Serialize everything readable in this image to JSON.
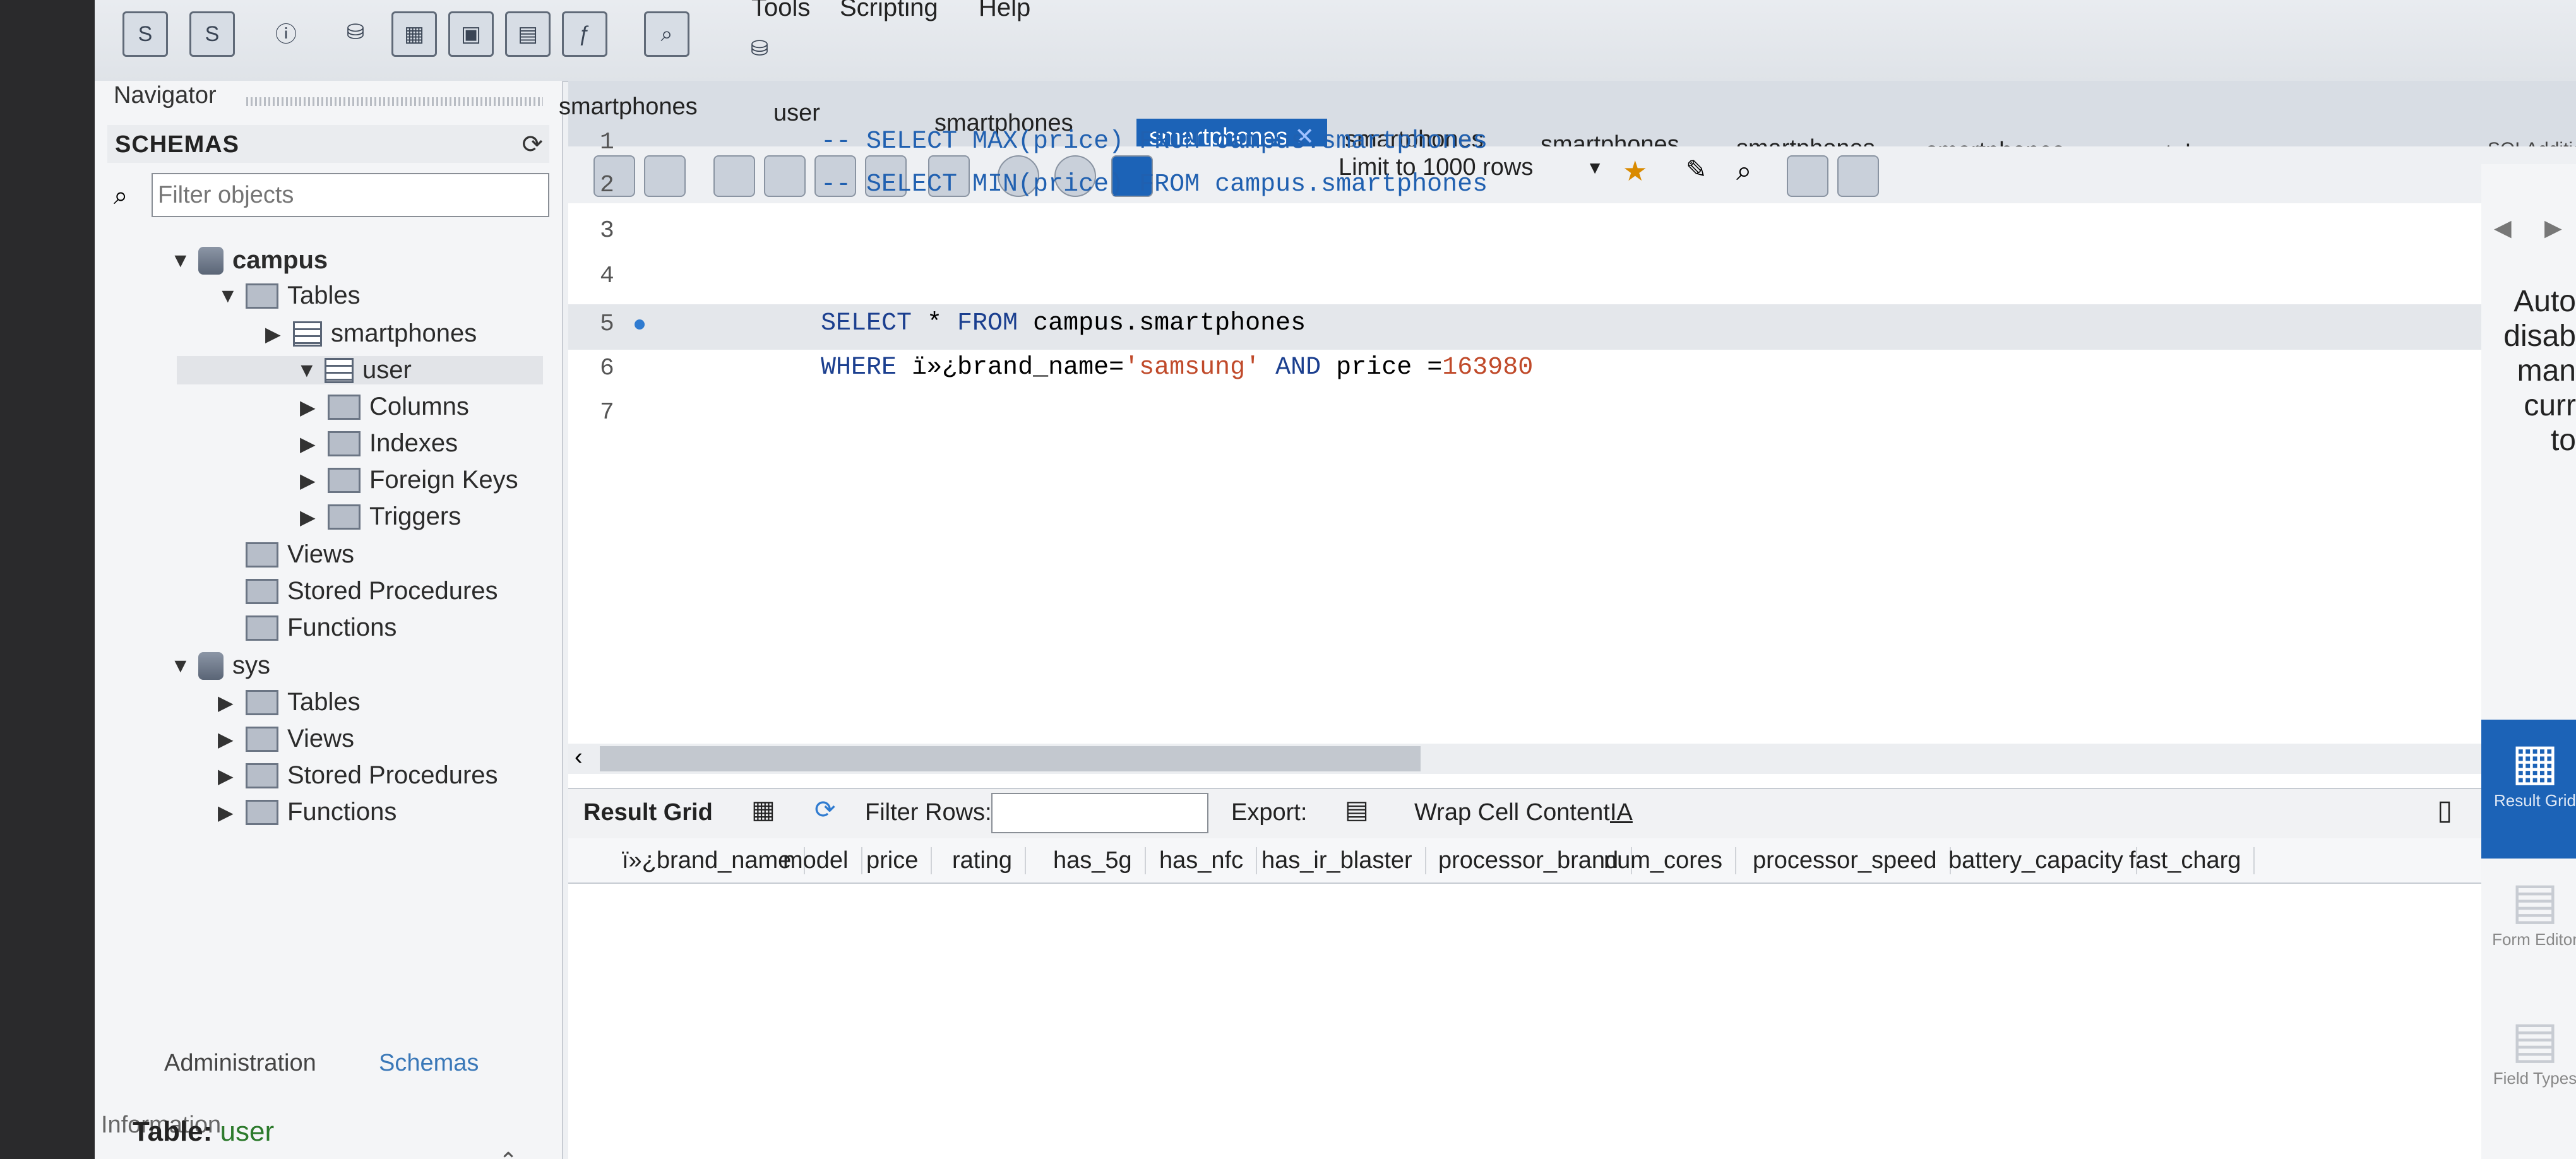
{
  "menu": {
    "items": [
      "Tools",
      "Scripting",
      "Help"
    ]
  },
  "toolbar": {
    "icons": [
      "new-sql-tab-icon",
      "open-sql-script-icon",
      "open-inspector-icon",
      "create-schema-icon",
      "create-table-icon",
      "create-view-icon",
      "create-procedure-icon",
      "create-function-icon",
      "search-table-data-icon",
      "reconnect-icon"
    ]
  },
  "navigator": {
    "title": "Navigator",
    "schemas_label": "SCHEMAS",
    "filter_placeholder": "Filter objects",
    "tree": [
      {
        "label": "campus",
        "level": 0,
        "expanded": true,
        "kind": "db",
        "bold": true
      },
      {
        "label": "Tables",
        "level": 1,
        "expanded": true,
        "kind": "folder"
      },
      {
        "label": "smartphones",
        "level": 2,
        "expanded": false,
        "kind": "table"
      },
      {
        "label": "user",
        "level": 2,
        "expanded": true,
        "kind": "table",
        "selected": true
      },
      {
        "label": "Columns",
        "level": 3,
        "expanded": false,
        "kind": "folder"
      },
      {
        "label": "Indexes",
        "level": 3,
        "expanded": false,
        "kind": "folder"
      },
      {
        "label": "Foreign Keys",
        "level": 3,
        "expanded": false,
        "kind": "folder"
      },
      {
        "label": "Triggers",
        "level": 3,
        "expanded": false,
        "kind": "folder"
      },
      {
        "label": "Views",
        "level": 1,
        "kind": "folder"
      },
      {
        "label": "Stored Procedures",
        "level": 1,
        "kind": "folder"
      },
      {
        "label": "Functions",
        "level": 1,
        "kind": "folder"
      },
      {
        "label": "sys",
        "level": 0,
        "expanded": true,
        "kind": "db"
      },
      {
        "label": "Tables",
        "level": 1,
        "expanded": false,
        "kind": "folder"
      },
      {
        "label": "Views",
        "level": 1,
        "expanded": false,
        "kind": "folder"
      },
      {
        "label": "Stored Procedures",
        "level": 1,
        "expanded": false,
        "kind": "folder"
      },
      {
        "label": "Functions",
        "level": 1,
        "expanded": false,
        "kind": "folder"
      }
    ],
    "tabs": [
      "Administration",
      "Schemas"
    ],
    "info_title": "Information",
    "info_table_label": "Table:",
    "info_table_value": "user"
  },
  "editor": {
    "tabs": [
      "smartphones",
      "user",
      "smartphones",
      "smartphones",
      "smartphones",
      "smartphones",
      "smartphones",
      "smartphones",
      "smartphones"
    ],
    "active_tab": 3,
    "limit_label": "Limit to 1000 rows",
    "right_label": "SQLAdditions",
    "lines": [
      {
        "n": "1",
        "text": "-- SELECT MAX(price) FROM campus.smartphones"
      },
      {
        "n": "2",
        "text": "-- SELECT MIN(price) FROM campus.smartphones"
      },
      {
        "n": "3",
        "text": ""
      },
      {
        "n": "4",
        "text": ""
      },
      {
        "n": "5",
        "text": "SELECT * FROM campus.smartphones"
      },
      {
        "n": "6",
        "text": "WHERE ï»¿brand_name='samsung' AND price =163980"
      },
      {
        "n": "7",
        "text": ""
      }
    ]
  },
  "result": {
    "title": "Result Grid",
    "filter_label": "Filter Rows:",
    "export_label": "Export:",
    "wrap_label": "Wrap Cell Content:",
    "columns": [
      "ï»¿brand_name",
      "model",
      "price",
      "rating",
      "has_5g",
      "has_nfc",
      "has_ir_blaster",
      "processor_brand",
      "num_cores",
      "processor_speed",
      "battery_capacity",
      "fast_charg"
    ]
  },
  "sidepanel": {
    "context_help": [
      "Auto",
      "disab",
      "man",
      "curr",
      "to"
    ],
    "buttons": [
      "Result Grid",
      "Form Editor",
      "Field Types"
    ]
  },
  "colors": {
    "accent": "#1c63b7",
    "keyword": "#1b3f8f",
    "string": "#c04a2a"
  }
}
